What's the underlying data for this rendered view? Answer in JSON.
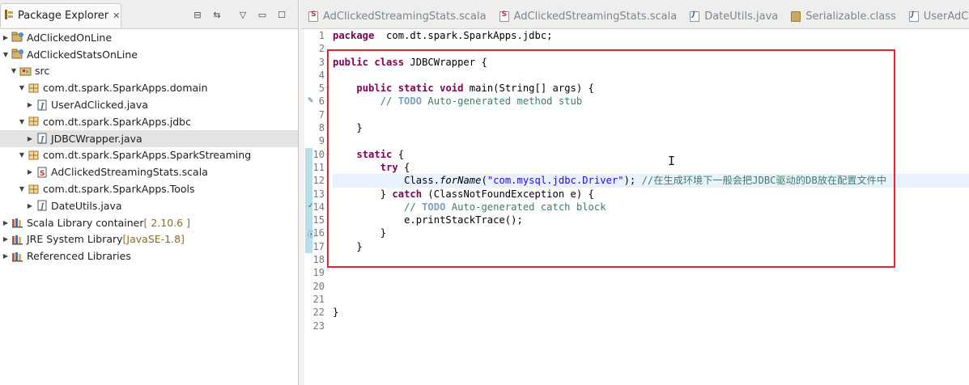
{
  "explorer": {
    "tab_label": "Package Explorer",
    "close_glyph": "✕",
    "toolbar": [
      {
        "name": "collapse-all-icon",
        "glyph": "⊟"
      },
      {
        "name": "link-with-editor-icon",
        "glyph": "⇆"
      },
      {
        "name": "view-menu-icon",
        "glyph": "▽"
      },
      {
        "name": "minimize-icon",
        "glyph": "▭"
      },
      {
        "name": "maximize-icon",
        "glyph": "☐"
      }
    ],
    "tree": [
      {
        "label": "AdClickedOnLine",
        "indent": 0,
        "twisty": "▶",
        "icon": "project-icon",
        "version": ""
      },
      {
        "label": "AdClickedStatsOnLine",
        "indent": 0,
        "twisty": "▼",
        "icon": "project-icon",
        "version": ""
      },
      {
        "label": "src",
        "indent": 1,
        "twisty": "▼",
        "icon": "source-folder-icon",
        "version": ""
      },
      {
        "label": "com.dt.spark.SparkApps.domain",
        "indent": 2,
        "twisty": "▼",
        "icon": "package-icon",
        "version": ""
      },
      {
        "label": "UserAdClicked.java",
        "indent": 3,
        "twisty": "▶",
        "icon": "java-file-icon",
        "version": ""
      },
      {
        "label": "com.dt.spark.SparkApps.jdbc",
        "indent": 2,
        "twisty": "▼",
        "icon": "package-icon",
        "version": ""
      },
      {
        "label": "JDBCWrapper.java",
        "indent": 3,
        "twisty": "▶",
        "icon": "java-file-icon",
        "version": "",
        "selected": true
      },
      {
        "label": "com.dt.spark.SparkApps.SparkStreaming",
        "indent": 2,
        "twisty": "▼",
        "icon": "package-icon",
        "version": ""
      },
      {
        "label": "AdClickedStreamingStats.scala",
        "indent": 3,
        "twisty": "▶",
        "icon": "scala-file-icon",
        "version": ""
      },
      {
        "label": "com.dt.spark.SparkApps.Tools",
        "indent": 2,
        "twisty": "▼",
        "icon": "package-icon",
        "version": ""
      },
      {
        "label": "DateUtils.java",
        "indent": 3,
        "twisty": "▶",
        "icon": "java-file-icon",
        "version": ""
      },
      {
        "label": "Scala Library container ",
        "indent": 0,
        "twisty": "▶",
        "icon": "library-icon",
        "version": "[ 2.10.6 ]"
      },
      {
        "label": "JRE System Library ",
        "indent": 0,
        "twisty": "▶",
        "icon": "library-icon",
        "version": "[JavaSE-1.8]"
      },
      {
        "label": "Referenced Libraries",
        "indent": 0,
        "twisty": "▶",
        "icon": "library-icon",
        "version": ""
      }
    ]
  },
  "editor": {
    "tabs": [
      {
        "label": "AdClickedStreamingStats.scala",
        "icon": "s"
      },
      {
        "label": "AdClickedStreamingStats.scala",
        "icon": "s"
      },
      {
        "label": "DateUtils.java",
        "icon": "j"
      },
      {
        "label": "Serializable.class",
        "icon": "c"
      },
      {
        "label": "UserAdCli",
        "icon": "j"
      }
    ],
    "line_numbers": [
      "1",
      "2",
      "3",
      "4",
      "5",
      "6",
      "7",
      "8",
      "9",
      "10",
      "11",
      "12",
      "13",
      "14",
      "15",
      "16",
      "17",
      "18",
      "19",
      "20",
      "21",
      "22",
      "23"
    ],
    "code": [
      {
        "indent": "",
        "parts": [
          [
            "kw",
            "package"
          ],
          [
            "",
            "  com.dt.spark.SparkApps.jdbc;"
          ]
        ]
      },
      {
        "indent": "",
        "parts": []
      },
      {
        "indent": "",
        "parts": [
          [
            "kw",
            "public"
          ],
          [
            "",
            " "
          ],
          [
            "kw",
            "class"
          ],
          [
            "",
            " JDBCWrapper {"
          ]
        ]
      },
      {
        "indent": "",
        "parts": []
      },
      {
        "indent": "    ",
        "parts": [
          [
            "kw",
            "public"
          ],
          [
            "",
            " "
          ],
          [
            "kw",
            "static"
          ],
          [
            "",
            " "
          ],
          [
            "kw",
            "void"
          ],
          [
            "",
            " main(String[] args) {"
          ]
        ]
      },
      {
        "indent": "        ",
        "parts": [
          [
            "cm",
            "// "
          ],
          [
            "todo",
            "TODO"
          ],
          [
            "cm",
            " Auto-generated method stub"
          ]
        ]
      },
      {
        "indent": "",
        "parts": []
      },
      {
        "indent": "    ",
        "parts": [
          [
            "",
            "}"
          ]
        ]
      },
      {
        "indent": "",
        "parts": []
      },
      {
        "indent": "    ",
        "parts": [
          [
            "kw",
            "static"
          ],
          [
            "",
            " {"
          ]
        ]
      },
      {
        "indent": "        ",
        "parts": [
          [
            "kw",
            "try"
          ],
          [
            "",
            " {"
          ]
        ]
      },
      {
        "indent": "            ",
        "parts": [
          [
            "",
            "Class."
          ],
          [
            "it",
            "forName"
          ],
          [
            "",
            "("
          ],
          [
            "str",
            "\"com.mysql.jdbc.Driver\""
          ],
          [
            "",
            "); "
          ],
          [
            "cm",
            "//在生成环境下一般会把JDBC驱动的DB放在配置文件中"
          ]
        ],
        "current": true
      },
      {
        "indent": "        ",
        "parts": [
          [
            "",
            "} "
          ],
          [
            "kw",
            "catch"
          ],
          [
            "",
            " (ClassNotFoundException e) {"
          ]
        ]
      },
      {
        "indent": "            ",
        "parts": [
          [
            "cm",
            "// "
          ],
          [
            "todo",
            "TODO"
          ],
          [
            "cm",
            " Auto-generated catch block"
          ]
        ]
      },
      {
        "indent": "            ",
        "parts": [
          [
            "",
            "e.printStackTrace();"
          ]
        ]
      },
      {
        "indent": "        ",
        "parts": [
          [
            "",
            "}"
          ]
        ]
      },
      {
        "indent": "    ",
        "parts": [
          [
            "",
            "}"
          ]
        ]
      },
      {
        "indent": "",
        "parts": []
      },
      {
        "indent": "",
        "parts": []
      },
      {
        "indent": "",
        "parts": []
      },
      {
        "indent": "",
        "parts": []
      },
      {
        "indent": "",
        "parts": [
          [
            "",
            "}"
          ]
        ]
      },
      {
        "indent": "",
        "parts": []
      }
    ]
  },
  "colors": {
    "keyword": "#7f0055",
    "comment": "#3f7f5f",
    "string": "#2a00ff",
    "highlight_box": "#e3242b"
  }
}
